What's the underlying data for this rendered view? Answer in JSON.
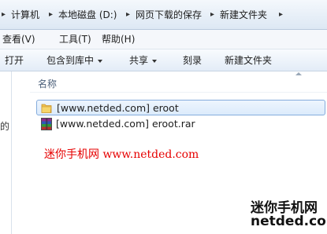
{
  "breadcrumb": {
    "items": [
      "计算机",
      "本地磁盘 (D:)",
      "网页下载的保存",
      "新建文件夹"
    ]
  },
  "menubar": {
    "items": [
      "查看(V)",
      "工具(T)",
      "帮助(H)"
    ]
  },
  "toolbar": {
    "open": "打开",
    "include": "包含到库中",
    "share": "共享",
    "burn": "刻录",
    "new_folder": "新建文件夹"
  },
  "nav": {
    "clipped_text": "的"
  },
  "columns": {
    "name": "名称"
  },
  "files": [
    {
      "name": "[www.netded.com] eroot",
      "type": "folder",
      "selected": true
    },
    {
      "name": "[www.netded.com] eroot.rar",
      "type": "rar",
      "selected": false
    }
  ],
  "watermarks": {
    "red": "迷你手机网 www.netded.com",
    "brand_line1": "迷你手机网",
    "brand_line2": "netded.com"
  },
  "colors": {
    "selection": "#dcebfc",
    "watermark": "#e60000"
  }
}
